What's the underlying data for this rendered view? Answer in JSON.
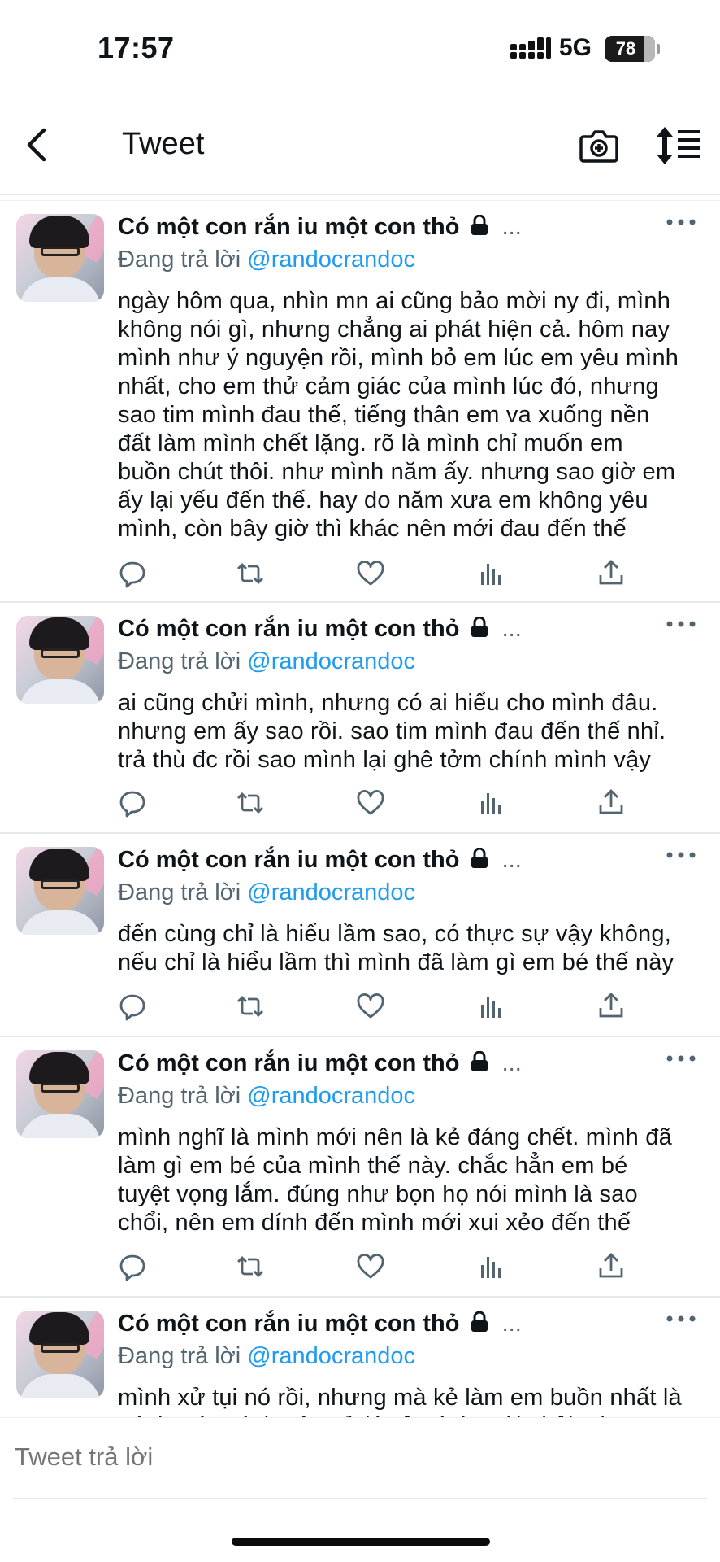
{
  "status": {
    "time": "17:57",
    "network": "5G",
    "battery": "78"
  },
  "nav": {
    "title": "Tweet"
  },
  "tweets": [
    {
      "name": "Có một con rắn iu một con thỏ",
      "ellipsis": "...",
      "reply_prefix": "Đang trả lời",
      "handle": "@randocrandoc",
      "text": "ngày hôm qua, nhìn mn ai cũng bảo mời ny đi, mình\nkhông nói gì, nhưng chẳng ai phát hiện cả. hôm nay\nmình như ý nguyện rồi, mình bỏ em lúc em yêu mình\nnhất, cho em thử cảm giác của mình lúc đó, nhưng\nsao tim mình đau thế, tiếng thân em va xuống nền\nđất làm mình chết lặng. rõ là mình chỉ muốn em\nbuồn chút thôi. như mình năm ấy. nhưng sao giờ em\nấy lại yếu đến thế. hay do năm xưa em không yêu\nmình, còn bây giờ thì khác nên mới đau đến thế"
    },
    {
      "name": "Có một con rắn iu một con thỏ",
      "ellipsis": "...",
      "reply_prefix": "Đang trả lời",
      "handle": "@randocrandoc",
      "text": "ai cũng chửi mình, nhưng có ai hiểu cho mình đâu.\nnhưng em ấy sao rồi. sao tim mình đau đến thế nhỉ.\ntrả thù đc rồi sao mình lại ghê tởm chính mình vậy"
    },
    {
      "name": "Có một con rắn iu một con thỏ",
      "ellipsis": "...",
      "reply_prefix": "Đang trả lời",
      "handle": "@randocrandoc",
      "text": "đến cùng chỉ là hiểu lầm sao, có thực sự vậy không,\nnếu chỉ là hiểu lầm thì mình đã làm gì em bé thế này"
    },
    {
      "name": "Có một con rắn iu một con thỏ",
      "ellipsis": "...",
      "reply_prefix": "Đang trả lời",
      "handle": "@randocrandoc",
      "text": "mình nghĩ là mình mới nên là kẻ đáng chết. mình đã\nlàm gì em bé của mình thế này. chắc hẳn em bé\ntuyệt vọng lắm. đúng như bọn họ nói mình là sao\nchổi, nên em dính đến mình mới xui xẻo đến thế"
    },
    {
      "name": "Có một con rắn iu một con thỏ",
      "ellipsis": "...",
      "reply_prefix": "Đang trả lời",
      "handle": "@randocrandoc",
      "text": "mình xử tụi nó rồi, nhưng mà kẻ làm em buồn nhất là\nmình mà, mình nên xử lý cả mình mới phải, nhưng"
    }
  ],
  "composer": {
    "placeholder": "Tweet trả lời"
  },
  "colors": {
    "accent": "#1d9bf0",
    "text": "#0f1419",
    "muted": "#536471",
    "divider": "#e6e8ea"
  },
  "icons": [
    "back-arrow-icon",
    "camera-plus-icon",
    "sort-icon",
    "lock-icon",
    "more-icon",
    "reply-icon",
    "retweet-icon",
    "like-icon",
    "analytics-icon",
    "share-icon"
  ]
}
